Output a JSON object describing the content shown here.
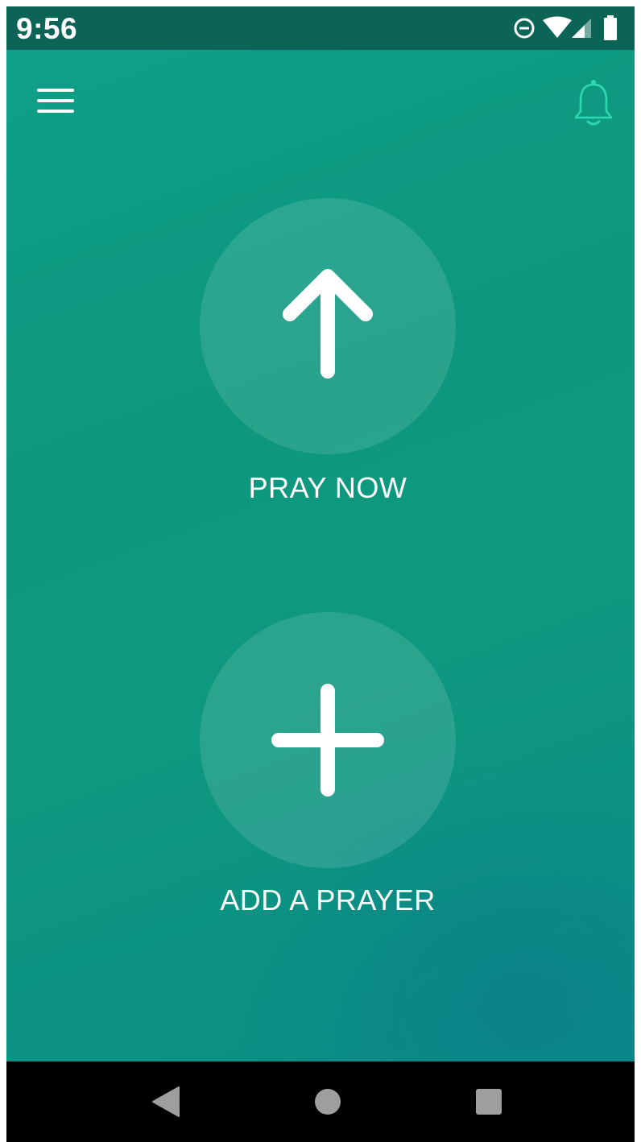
{
  "status_bar": {
    "time": "9:56",
    "icons": [
      "do-not-disturb-icon",
      "wifi-icon",
      "signal-icon",
      "battery-icon"
    ]
  },
  "header": {
    "menu_icon": "hamburger-menu-icon",
    "notification_icon": "bell-icon"
  },
  "actions": {
    "pray_now": {
      "label": "PRAY NOW",
      "icon": "arrow-up-icon"
    },
    "add_prayer": {
      "label": "ADD A PRAYER",
      "icon": "plus-icon"
    }
  },
  "nav_bar": {
    "buttons": [
      "back-icon",
      "home-icon",
      "recents-icon"
    ]
  },
  "colors": {
    "status_bar": "#0b6455",
    "background_primary": "#0f9f88",
    "background_accent": "#0a8d86",
    "bell_accent": "#2fd8b3",
    "text": "#ffffff",
    "nav_bar": "#000000",
    "nav_icon": "#9e9e9e"
  }
}
